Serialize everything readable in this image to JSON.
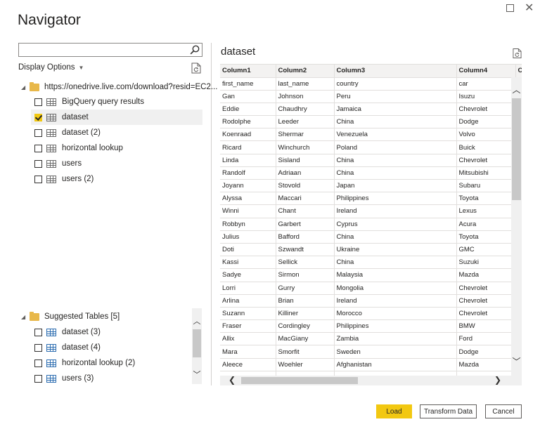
{
  "window": {
    "title": "Navigator",
    "maximize_icon": "maximize-icon",
    "close_glyph": "✕"
  },
  "left_pane": {
    "search": {
      "value": "",
      "placeholder": ""
    },
    "display_options_label": "Display Options",
    "root": {
      "label": "https://onedrive.live.com/download?resid=EC2..."
    },
    "items": [
      {
        "label": "BigQuery query results",
        "checked": false,
        "selected": false
      },
      {
        "label": "dataset",
        "checked": true,
        "selected": true
      },
      {
        "label": "dataset (2)",
        "checked": false,
        "selected": false
      },
      {
        "label": "horizontal lookup",
        "checked": false,
        "selected": false
      },
      {
        "label": "users",
        "checked": false,
        "selected": false
      },
      {
        "label": "users (2)",
        "checked": false,
        "selected": false
      }
    ],
    "suggested": {
      "label": "Suggested Tables [5]",
      "items": [
        {
          "label": "dataset (3)"
        },
        {
          "label": "dataset (4)"
        },
        {
          "label": "horizontal lookup (2)"
        },
        {
          "label": "users (3)"
        }
      ]
    }
  },
  "preview": {
    "title": "dataset",
    "columns": [
      "Column1",
      "Column2",
      "Column3",
      "Column4",
      "Co"
    ],
    "rows": [
      [
        "first_name",
        "last_name",
        "country",
        "car"
      ],
      [
        "Gan",
        "Johnson",
        "Peru",
        "Isuzu"
      ],
      [
        "Eddie",
        "Chaudhry",
        "Jamaica",
        "Chevrolet"
      ],
      [
        "Rodolphe",
        "Leeder",
        "China",
        "Dodge"
      ],
      [
        "Koenraad",
        "Shermar",
        "Venezuela",
        "Volvo"
      ],
      [
        "Ricard",
        "Winchurch",
        "Poland",
        "Buick"
      ],
      [
        "Linda",
        "Sisland",
        "China",
        "Chevrolet"
      ],
      [
        "Randolf",
        "Adriaan",
        "China",
        "Mitsubishi"
      ],
      [
        "Joyann",
        "Stovold",
        "Japan",
        "Subaru"
      ],
      [
        "Alyssa",
        "Maccari",
        "Philippines",
        "Toyota"
      ],
      [
        "Winni",
        "Chant",
        "Ireland",
        "Lexus"
      ],
      [
        "Robbyn",
        "Garbert",
        "Cyprus",
        "Acura"
      ],
      [
        "Julius",
        "Bafford",
        "China",
        "Toyota"
      ],
      [
        "Doti",
        "Szwandt",
        "Ukraine",
        "GMC"
      ],
      [
        "Kassi",
        "Sellick",
        "China",
        "Suzuki"
      ],
      [
        "Sadye",
        "Sirmon",
        "Malaysia",
        "Mazda"
      ],
      [
        "Lorri",
        "Gurry",
        "Mongolia",
        "Chevrolet"
      ],
      [
        "Arlina",
        "Brian",
        "Ireland",
        "Chevrolet"
      ],
      [
        "Suzann",
        "Killiner",
        "Morocco",
        "Chevrolet"
      ],
      [
        "Fraser",
        "Cordingley",
        "Philippines",
        "BMW"
      ],
      [
        "Allix",
        "MacGiany",
        "Zambia",
        "Ford"
      ],
      [
        "Mara",
        "Smorfit",
        "Sweden",
        "Dodge"
      ],
      [
        "Aleece",
        "Woehler",
        "Afghanistan",
        "Mazda"
      ],
      [
        "",
        "",
        "",
        ""
      ]
    ]
  },
  "footer": {
    "load_label": "Load",
    "transform_label": "Transform Data",
    "cancel_label": "Cancel"
  },
  "colors": {
    "accent": "#f2c811",
    "folder": "#e8b84a",
    "table_icon_blue": "#2b6cb0"
  }
}
